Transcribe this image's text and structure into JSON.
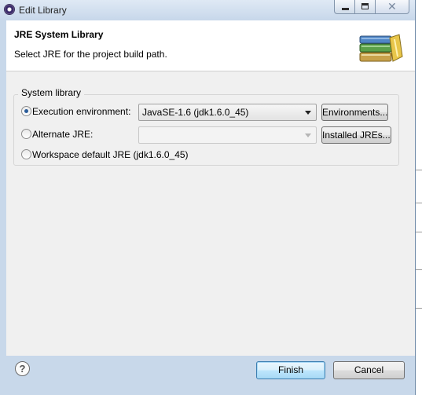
{
  "window": {
    "title": "Edit Library"
  },
  "header": {
    "title": "JRE System Library",
    "description": "Select JRE for the project build path."
  },
  "group": {
    "label": "System library",
    "options": [
      {
        "label": "Execution environment:",
        "checked": true,
        "combo_value": "JavaSE-1.6 (jdk1.6.0_45)",
        "button_label": "Environments..."
      },
      {
        "label": "Alternate JRE:",
        "checked": false,
        "combo_value": "",
        "button_label": "Installed JREs..."
      },
      {
        "label": "Workspace default JRE (jdk1.6.0_45)",
        "checked": false
      }
    ]
  },
  "footer": {
    "help_symbol": "?",
    "finish_label": "Finish",
    "cancel_label": "Cancel"
  },
  "colors": {
    "titlebar": "#c7d7ea",
    "dialog_background": "#f0f0f0",
    "default_button_border": "#3c7fb1",
    "radio_dot": "#2b5d9a"
  },
  "icons": [
    "app-icon",
    "minimize-icon",
    "maximize-icon",
    "close-icon",
    "library-books-icon",
    "help-icon",
    "dropdown-arrow-icon"
  ]
}
